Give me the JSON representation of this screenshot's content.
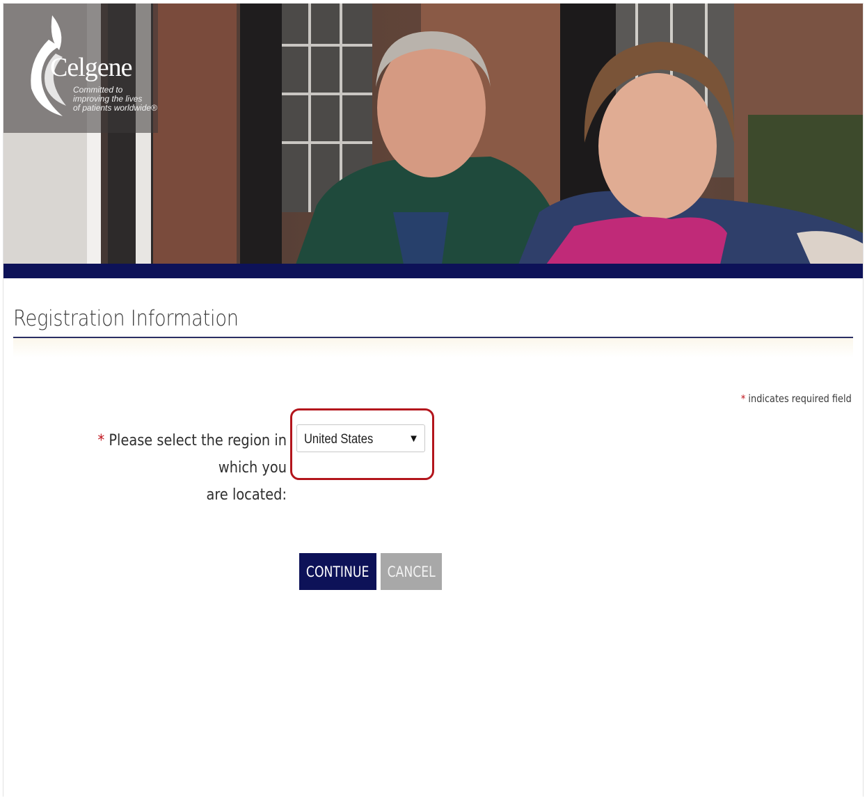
{
  "brand": {
    "name": "Celgene",
    "tagline_lines": [
      "Committed to",
      "improving the lives",
      "of patients worldwide®"
    ]
  },
  "page": {
    "title": "Registration Information",
    "required_star": "*",
    "required_note": "indicates required field"
  },
  "form": {
    "region_label_line1": "Please select the region in which you",
    "region_label_line2": "are located:",
    "region_value": "United States",
    "caret": "▼"
  },
  "buttons": {
    "continue": "CONTINUE",
    "cancel": "CANCEL"
  },
  "colors": {
    "navy": "#0d1258",
    "required_red": "#c0141c",
    "highlight_red": "#b3151c",
    "cancel_gray": "#a8a8a8"
  }
}
